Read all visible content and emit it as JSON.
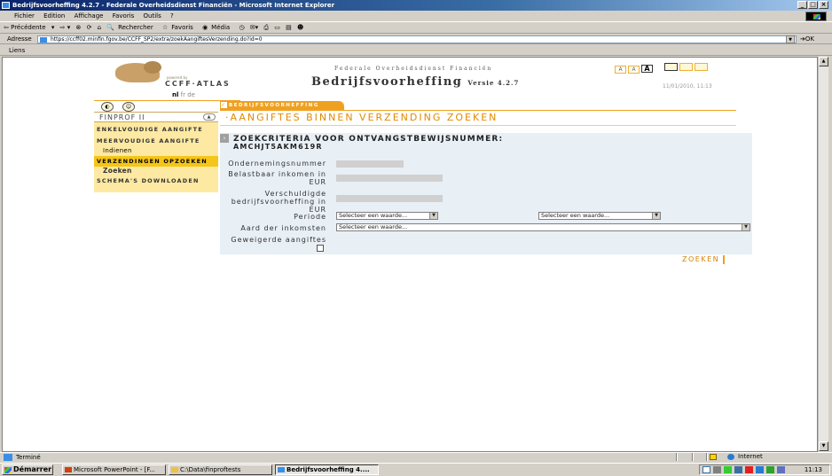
{
  "window": {
    "title": "Bedrijfsvoorheffing 4.2.7 - Federale Overheidsdienst Financiën - Microsoft Internet Explorer"
  },
  "menu": [
    "Fichier",
    "Edition",
    "Affichage",
    "Favoris",
    "Outils",
    "?"
  ],
  "toolbar": {
    "back": "⇦ Précédente",
    "search": "Rechercher",
    "favorites": "Favoris",
    "media": "Média"
  },
  "address": {
    "label": "Adresse",
    "url": "https://ccff02.minfin.fgov.be/CCFF_SP2/extra/zoekAangiftesVerzending.do?id=0",
    "go": "OK"
  },
  "links_label": "Liens",
  "header": {
    "powered_by": "powered by",
    "logo_text": "CCFF·ATLAS",
    "agency": "Federale Overheidsdienst Financiën",
    "app_title": "Bedrijfsvoorheffing",
    "version": "Versie 4.2.7",
    "datetime": "11/01/2010, 11:13",
    "font_buttons": [
      "A",
      "A",
      "A"
    ],
    "lang_nl": "nl",
    "lang_fr": "fr",
    "lang_de": "de"
  },
  "sidebar": {
    "profile": "FINPROF II",
    "items": [
      {
        "label": "ENKELVOUDIGE AANGIFTE"
      },
      {
        "label": "MEERVOUDIGE AANGIFTE"
      },
      {
        "label": "Indienen"
      },
      {
        "label": "VERZENDINGEN OPZOEKEN"
      },
      {
        "label": "Zoeken"
      },
      {
        "label": "SCHEMA'S DOWNLOADEN"
      }
    ]
  },
  "main": {
    "tab": "BEDRIJFSVOORHEFFING",
    "title": "·AANGIFTES BINNEN VERZENDING ZOEKEN",
    "criteria_title": "ZOEKCRITERIA VOOR ONTVANGSTBEWIJSNUMMER:",
    "criteria_number": "AMCHJT5AKM619R",
    "fields": {
      "ondernemingsnummer": "Ondernemingsnummer",
      "belastbaar_1": "Belastbaar inkomen in",
      "belastbaar_2": "EUR",
      "verschuldigde_1": "Verschuldigde",
      "verschuldigde_2": "bedrijfsvoorheffing in",
      "verschuldigde_3": "EUR",
      "periode": "Periode",
      "aard": "Aard der inkomsten",
      "geweigerde": "Geweigerde aangiftes"
    },
    "select_placeholder": "Selecteer een waarde...",
    "search_button": "ZOEKEN"
  },
  "status": {
    "text": "Terminé",
    "zone": "Internet"
  },
  "taskbar": {
    "start": "Démarrer",
    "tasks": [
      {
        "label": "Microsoft PowerPoint - [F..."
      },
      {
        "label": "C:\\Data\\finproftests"
      },
      {
        "label": "Bedrijfsvoorheffing 4...."
      }
    ],
    "clock": "11:13"
  },
  "colors": {
    "accent": "#f0a020",
    "title_orange": "#e08a00",
    "sidebar_bg": "#fde9a2",
    "active_nav": "#f5c518",
    "form_bg": "#e8eff5"
  }
}
